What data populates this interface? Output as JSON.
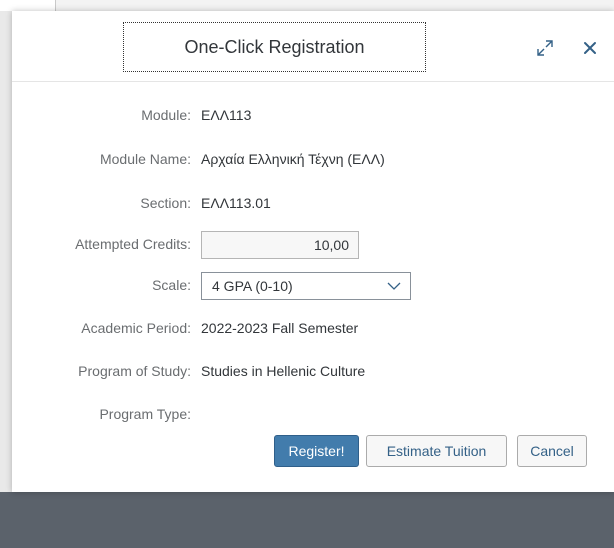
{
  "dialog": {
    "title": "One-Click Registration",
    "expand_icon": "expand-icon",
    "close_icon": "close-icon"
  },
  "fields": {
    "module": {
      "label": "Module:",
      "value": "ΕΛΛ113"
    },
    "module_name": {
      "label": "Module Name:",
      "value": "Αρχαία Ελληνική Τέχνη (ΕΛΛ)"
    },
    "section": {
      "label": "Section:",
      "value": "ΕΛΛ113.01"
    },
    "attempted_credits": {
      "label": "Attempted Credits:",
      "value": "10,00"
    },
    "scale": {
      "label": "Scale:",
      "value": "4 GPA (0-10)"
    },
    "academic_period": {
      "label": "Academic Period:",
      "value": "2022-2023 Fall Semester"
    },
    "program_of_study": {
      "label": "Program of Study:",
      "value": "Studies in Hellenic Culture"
    },
    "program_type": {
      "label": "Program Type:",
      "value": ""
    }
  },
  "buttons": {
    "register": "Register!",
    "estimate": "Estimate Tuition",
    "cancel": "Cancel"
  },
  "colors": {
    "primary_button": "#427cac",
    "overlay": "#5f6670"
  }
}
